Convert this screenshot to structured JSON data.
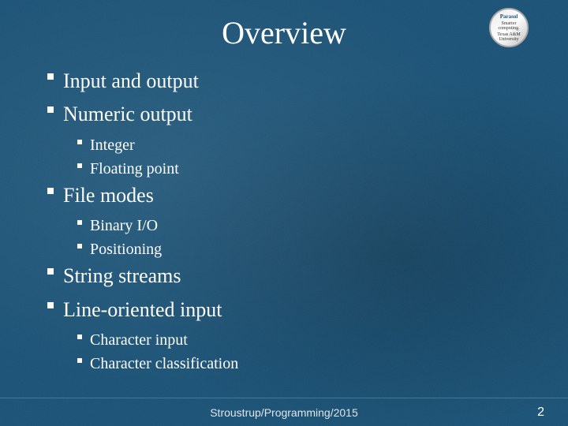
{
  "slide": {
    "title": "Overview",
    "bullets": [
      {
        "text": "Input and output",
        "sub": []
      },
      {
        "text": "Numeric output",
        "sub": [
          "Integer",
          "Floating point"
        ]
      },
      {
        "text": "File modes",
        "sub": [
          "Binary I/O",
          "Positioning"
        ]
      },
      {
        "text": "String streams",
        "sub": []
      },
      {
        "text": "Line-oriented input",
        "sub": [
          "Character input",
          "Character classification"
        ]
      }
    ],
    "footer": {
      "text": "Stroustrup/Programming/2015",
      "page": "2"
    },
    "logo": {
      "brand": "Parasol",
      "tagline1": "Smarter computing.",
      "tagline2": "Texas A&M University"
    }
  }
}
